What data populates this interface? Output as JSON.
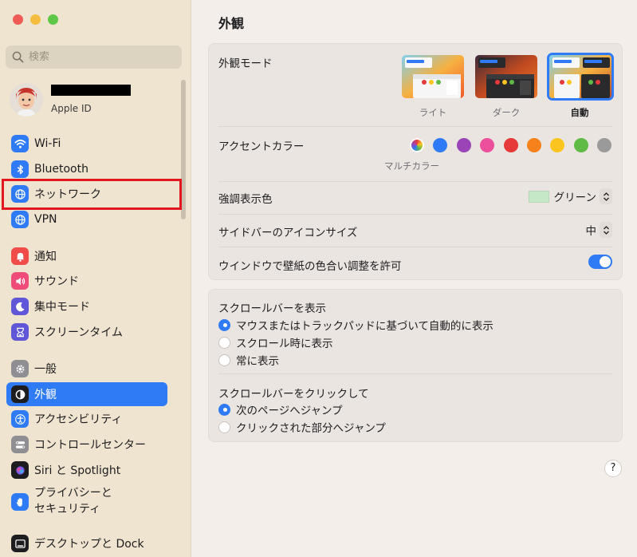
{
  "sidebar": {
    "search_placeholder": "検索",
    "account": {
      "subtitle": "Apple ID"
    },
    "items": [
      {
        "id": "wifi",
        "label": "Wi-Fi",
        "icon": "wifi-icon",
        "color": "#2f7bf5"
      },
      {
        "id": "bluetooth",
        "label": "Bluetooth",
        "icon": "bluetooth-icon",
        "color": "#2f7bf5"
      },
      {
        "id": "network",
        "label": "ネットワーク",
        "icon": "globe-icon",
        "color": "#2f7bf5"
      },
      {
        "id": "vpn",
        "label": "VPN",
        "icon": "vpn-globe-icon",
        "color": "#2f7bf5"
      },
      {
        "id": "notifications",
        "label": "通知",
        "icon": "bell-icon",
        "color": "#ef4c4a"
      },
      {
        "id": "sound",
        "label": "サウンド",
        "icon": "speaker-icon",
        "color": "#ef4c7a"
      },
      {
        "id": "focus",
        "label": "集中モード",
        "icon": "moon-icon",
        "color": "#5f57d8"
      },
      {
        "id": "screentime",
        "label": "スクリーンタイム",
        "icon": "hourglass-icon",
        "color": "#5f57d8"
      },
      {
        "id": "general",
        "label": "一般",
        "icon": "gear-icon",
        "color": "#8e8e93"
      },
      {
        "id": "appearance",
        "label": "外観",
        "icon": "appearance-icon",
        "color": "#1d1d1f"
      },
      {
        "id": "accessibility",
        "label": "アクセシビリティ",
        "icon": "accessibility-icon",
        "color": "#2f7bf5"
      },
      {
        "id": "controlcenter",
        "label": "コントロールセンター",
        "icon": "control-center-icon",
        "color": "#8e8e93"
      },
      {
        "id": "siri",
        "label": "Siri と Spotlight",
        "icon": "siri-icon",
        "color": "#1d1d1f"
      },
      {
        "id": "privacy",
        "label_line1": "プライバシーと",
        "label_line2": "セキュリティ",
        "icon": "hand-icon",
        "color": "#2f7bf5"
      },
      {
        "id": "desktop",
        "label": "デスクトップと Dock",
        "icon": "dock-icon",
        "color": "#1d1d1f"
      }
    ]
  },
  "main": {
    "title": "外観",
    "appearance_mode": {
      "label": "外観モード",
      "options": [
        {
          "label": "ライト",
          "selected": false
        },
        {
          "label": "ダーク",
          "selected": false
        },
        {
          "label": "自動",
          "selected": true
        }
      ]
    },
    "accent_color": {
      "label": "アクセントカラー",
      "selected_label": "マルチカラー",
      "colors": [
        "multicolor",
        "#2f7bf5",
        "#9b44b8",
        "#ec4f9b",
        "#e5393a",
        "#f7821b",
        "#fcc41e",
        "#5fba46",
        "#9a9a9a"
      ]
    },
    "highlight_color": {
      "label": "強調表示色",
      "value": "グリーン"
    },
    "sidebar_icon_size": {
      "label": "サイドバーのアイコンサイズ",
      "value": "中"
    },
    "wallpaper_tinting": {
      "label": "ウインドウで壁紙の色合い調整を許可",
      "enabled": true
    },
    "show_scrollbars": {
      "label": "スクロールバーを表示",
      "options": [
        {
          "label": "マウスまたはトラックパッドに基づいて自動的に表示",
          "selected": true
        },
        {
          "label": "スクロール時に表示",
          "selected": false
        },
        {
          "label": "常に表示",
          "selected": false
        }
      ]
    },
    "click_scrollbar": {
      "label": "スクロールバーをクリックして",
      "options": [
        {
          "label": "次のページへジャンプ",
          "selected": true
        },
        {
          "label": "クリックされた部分へジャンプ",
          "selected": false
        }
      ]
    },
    "help_label": "?"
  }
}
